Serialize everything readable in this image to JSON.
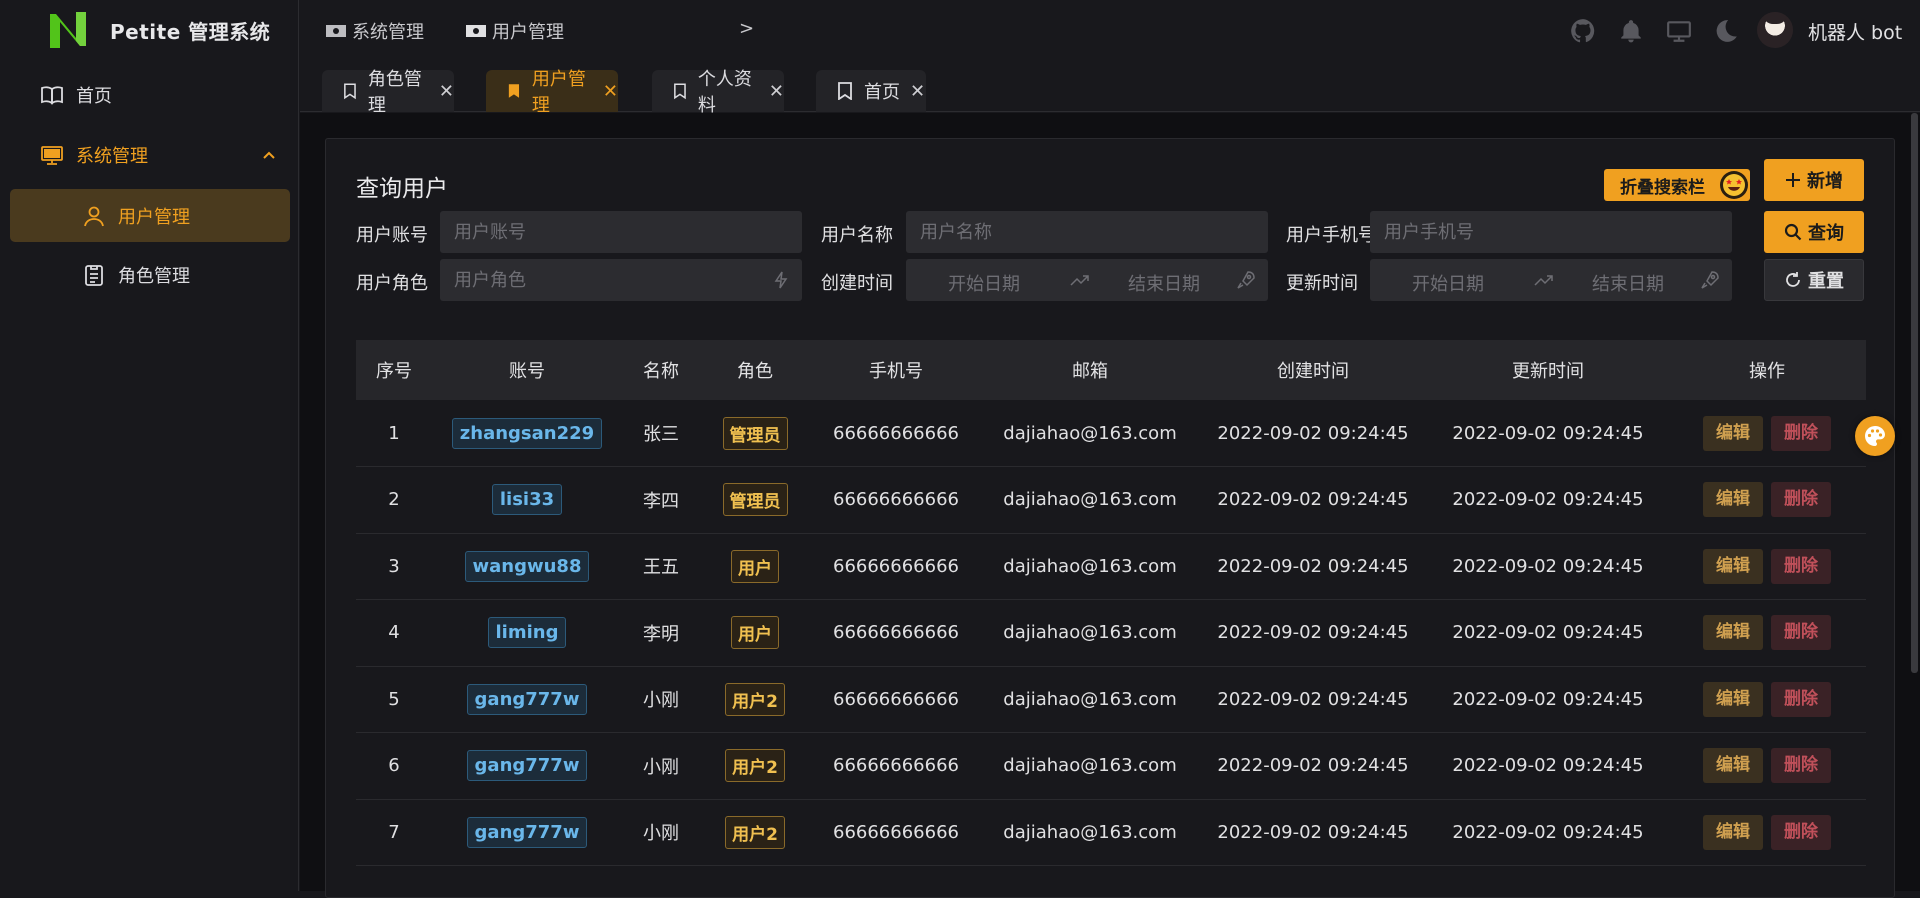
{
  "app": {
    "title": "Petite 管理系统",
    "accent": "#f0a020"
  },
  "sidebar": {
    "items": [
      {
        "label": "首页",
        "icon": "book-icon"
      },
      {
        "label": "系统管理",
        "icon": "monitor-icon"
      },
      {
        "label": "用户管理",
        "icon": "user-icon"
      },
      {
        "label": "角色管理",
        "icon": "clipboard-icon"
      }
    ]
  },
  "breadcrumb": {
    "items": [
      "系统管理",
      "用户管理"
    ],
    "separator": ">"
  },
  "header": {
    "user": "机器人 bot",
    "icons": [
      "github-icon",
      "bell-icon",
      "monitor-icon",
      "moon-icon"
    ]
  },
  "tabs": [
    {
      "label": "角色管理"
    },
    {
      "label": "用户管理"
    },
    {
      "label": "个人资料"
    },
    {
      "label": "首页"
    }
  ],
  "search": {
    "title": "查询用户",
    "fold_label": "折叠搜索栏",
    "add_label": "新增",
    "query_label": "查询",
    "reset_label": "重置",
    "fields": {
      "account": {
        "label": "用户账号",
        "placeholder": "用户账号"
      },
      "name": {
        "label": "用户名称",
        "placeholder": "用户名称"
      },
      "phone": {
        "label": "用户手机号",
        "placeholder": "用户手机号"
      },
      "role": {
        "label": "用户角色",
        "placeholder": "用户角色"
      },
      "created": {
        "label": "创建时间",
        "start": "开始日期",
        "end": "结束日期"
      },
      "updated": {
        "label": "更新时间",
        "start": "开始日期",
        "end": "结束日期"
      }
    }
  },
  "table": {
    "columns": [
      "序号",
      "账号",
      "名称",
      "角色",
      "手机号",
      "邮箱",
      "创建时间",
      "更新时间",
      "操作"
    ],
    "edit_label": "编辑",
    "delete_label": "删除",
    "rows": [
      {
        "no": "1",
        "account": "zhangsan229",
        "name": "张三",
        "role": "管理员",
        "phone": "66666666666",
        "email": "dajiahao@163.com",
        "created": "2022-09-02 09:24:45",
        "updated": "2022-09-02 09:24:45"
      },
      {
        "no": "2",
        "account": "lisi33",
        "name": "李四",
        "role": "管理员",
        "phone": "66666666666",
        "email": "dajiahao@163.com",
        "created": "2022-09-02 09:24:45",
        "updated": "2022-09-02 09:24:45"
      },
      {
        "no": "3",
        "account": "wangwu88",
        "name": "王五",
        "role": "用户",
        "phone": "66666666666",
        "email": "dajiahao@163.com",
        "created": "2022-09-02 09:24:45",
        "updated": "2022-09-02 09:24:45"
      },
      {
        "no": "4",
        "account": "liming",
        "name": "李明",
        "role": "用户",
        "phone": "66666666666",
        "email": "dajiahao@163.com",
        "created": "2022-09-02 09:24:45",
        "updated": "2022-09-02 09:24:45"
      },
      {
        "no": "5",
        "account": "gang777w",
        "name": "小刚",
        "role": "用户2",
        "phone": "66666666666",
        "email": "dajiahao@163.com",
        "created": "2022-09-02 09:24:45",
        "updated": "2022-09-02 09:24:45"
      },
      {
        "no": "6",
        "account": "gang777w",
        "name": "小刚",
        "role": "用户2",
        "phone": "66666666666",
        "email": "dajiahao@163.com",
        "created": "2022-09-02 09:24:45",
        "updated": "2022-09-02 09:24:45"
      },
      {
        "no": "7",
        "account": "gang777w",
        "name": "小刚",
        "role": "用户2",
        "phone": "66666666666",
        "email": "dajiahao@163.com",
        "created": "2022-09-02 09:24:45",
        "updated": "2022-09-02 09:24:45"
      }
    ]
  }
}
